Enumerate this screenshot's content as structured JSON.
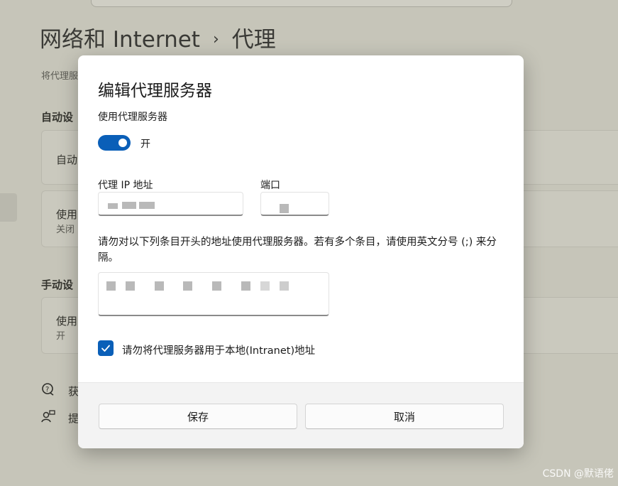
{
  "background": {
    "breadcrumb_parent": "网络和 Internet",
    "breadcrumb_sep": "›",
    "breadcrumb_current": "代理",
    "desc_partial": "将代理服",
    "section_auto": "自动设",
    "card1_title": "自动",
    "card2_title": "使用",
    "card2_sub": "关闭",
    "section_manual": "手动设",
    "card3_title": "使用",
    "card3_sub": "开",
    "help_link": "获",
    "feedback_link": "提"
  },
  "dialog": {
    "title": "编辑代理服务器",
    "use_proxy_label": "使用代理服务器",
    "toggle_state": "开",
    "ip_label": "代理 IP 地址",
    "ip_value": "",
    "port_label": "端口",
    "port_value": "",
    "exceptions_desc": "请勿对以下列条目开头的地址使用代理服务器。若有多个条目，请使用英文分号 (;) 来分隔。",
    "exceptions_value": "",
    "bypass_local_label": "请勿将代理服务器用于本地(Intranet)地址",
    "bypass_local_checked": true,
    "save_label": "保存",
    "cancel_label": "取消"
  },
  "colors": {
    "accent": "#0a5fb8",
    "overlay": "#c6c5b9"
  },
  "watermark": "CSDN @默语佬"
}
